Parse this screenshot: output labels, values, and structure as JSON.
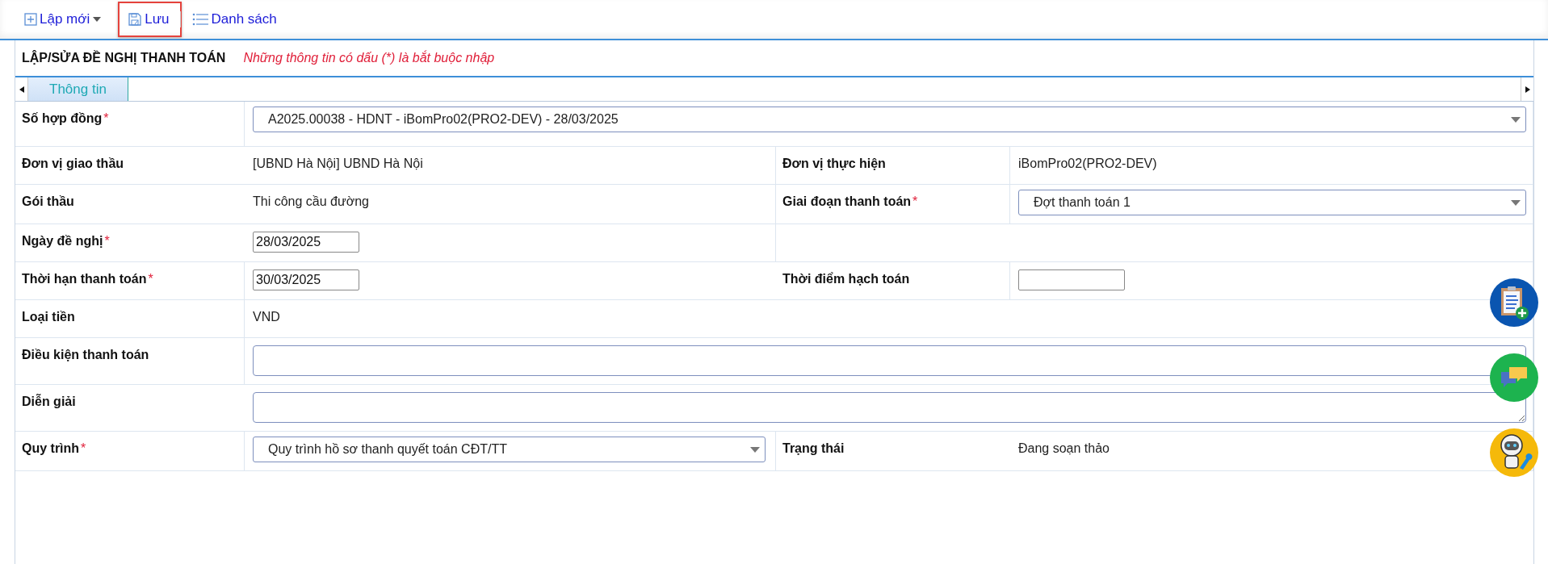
{
  "toolbar": [
    {
      "kind": "new",
      "label": "Lập mới",
      "highlighted": false
    },
    {
      "kind": "save",
      "label": "Lưu",
      "highlighted": true
    },
    {
      "kind": "list",
      "label": "Danh sách",
      "highlighted": false
    }
  ],
  "form": {
    "title": "LẬP/SỬA ĐỀ NGHỊ THANH TOÁN",
    "note": "Những thông tin có dấu (*) là bắt buộc nhập"
  },
  "tabs": [
    {
      "label": "Thông tin",
      "selected": true
    }
  ],
  "rows": [
    {
      "fields": [
        {
          "label": "Số hợp đồng",
          "required_mark": "*",
          "kind": "select",
          "value": "A2025.00038 - HDNT - iBomPro02(PRO2-DEV) - 28/03/2025"
        }
      ]
    },
    {
      "fields": [
        {
          "label": "Đơn vị giao thầu",
          "kind": "text",
          "value": "[UBND Hà Nội] UBND Hà Nội"
        },
        {
          "label": "Đơn vị thực hiện",
          "kind": "text",
          "value": "iBomPro02(PRO2-DEV)"
        }
      ]
    },
    {
      "fields": [
        {
          "label": "Gói thầu",
          "kind": "text",
          "value": "Thi công cầu đường"
        },
        {
          "label": "Giai đoạn thanh toán",
          "required_mark": "*",
          "kind": "select",
          "value": "Đợt thanh toán 1"
        }
      ]
    },
    {
      "fields": [
        {
          "label": "Ngày đề nghị",
          "required_mark": "*",
          "kind": "date",
          "value": "28/03/2025"
        }
      ]
    },
    {
      "fields": [
        {
          "label": "Thời hạn thanh toán",
          "required_mark": "*",
          "kind": "date",
          "value": "30/03/2025"
        },
        {
          "label": "Thời điểm hạch toán",
          "kind": "date"
        }
      ]
    },
    {
      "fields": [
        {
          "label": "Loại tiền",
          "kind": "text",
          "value": "VND"
        }
      ]
    },
    {
      "fields": [
        {
          "label": "Điều kiện thanh toán",
          "kind": "textarea"
        }
      ]
    },
    {
      "fields": [
        {
          "label": "Diễn giải",
          "kind": "textarea"
        }
      ]
    },
    {
      "fields": [
        {
          "label": "Quy trình",
          "required_mark": "*",
          "kind": "select",
          "value": "Quy trình hồ sơ thanh quyết toán CĐT/TT"
        },
        {
          "label": "Trạng thái",
          "kind": "text",
          "value": "Đang soạn thảo"
        }
      ]
    }
  ]
}
